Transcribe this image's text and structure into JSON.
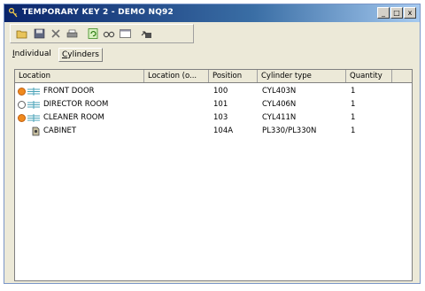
{
  "window": {
    "title": "TEMPORARY KEY 2 - DEMO NQ92",
    "controls": [
      "_",
      "□",
      "x"
    ]
  },
  "toolbar": {
    "buttons": [
      "open-icon",
      "save-icon",
      "delete-icon",
      "print-icon",
      "refresh-icon",
      "search-icon",
      "window-icon",
      "export-icon"
    ]
  },
  "tabs": [
    {
      "label_u": "I",
      "label_rest": "ndividual",
      "active": false
    },
    {
      "label_u": "C",
      "label_rest": "ylinders",
      "active": true
    }
  ],
  "table": {
    "columns": [
      "Location",
      "Location (o...",
      "Position",
      "Cylinder type",
      "Quantity"
    ],
    "rows": [
      {
        "status": "orange",
        "icon": "door-icon",
        "location": "FRONT DOOR",
        "position": "100",
        "cylinder_type": "CYL403N",
        "quantity": "1"
      },
      {
        "status": "empty",
        "icon": "door-icon",
        "location": "DIRECTOR ROOM",
        "position": "101",
        "cylinder_type": "CYL406N",
        "quantity": "1"
      },
      {
        "status": "orange",
        "icon": "door-icon",
        "location": "CLEANER ROOM",
        "position": "103",
        "cylinder_type": "CYL411N",
        "quantity": "1"
      },
      {
        "status": "none",
        "icon": "cabinet-icon",
        "location": "CABINET",
        "position": "104A",
        "cylinder_type": "PL330/PL330N",
        "quantity": "1"
      }
    ]
  },
  "colors": {
    "title_bar": "#0a246a",
    "status_orange": "#f08a1e",
    "door_icon": "#4aa3b8"
  }
}
